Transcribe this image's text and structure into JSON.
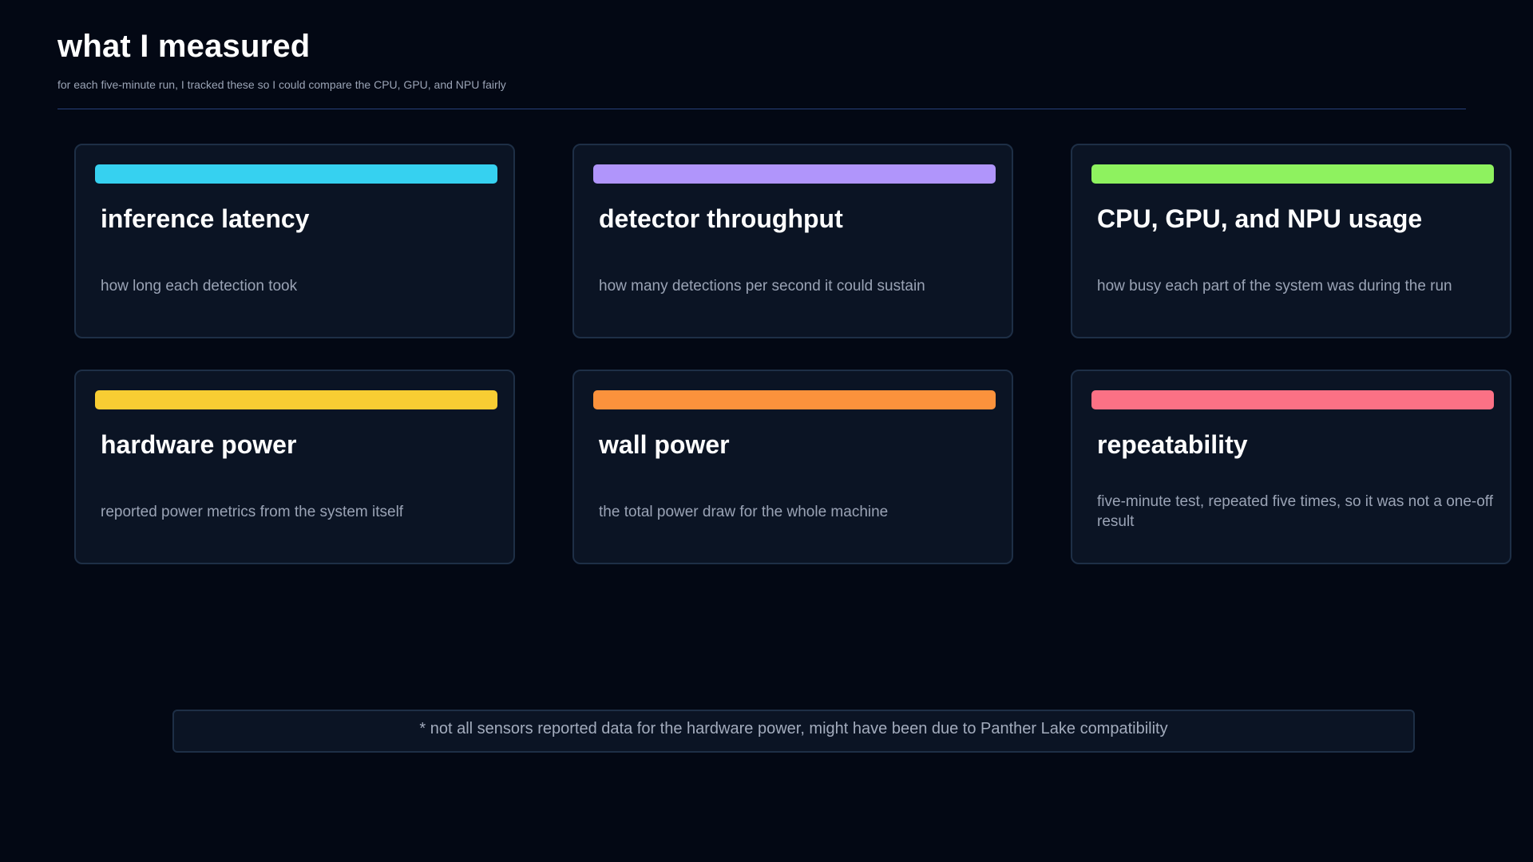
{
  "header": {
    "title": "what I measured",
    "subtitle": "for each five-minute run, I tracked these so I could compare the CPU, GPU, and NPU fairly"
  },
  "cards": [
    {
      "title": "inference latency",
      "description": "how long each detection took",
      "accent_color": "#36d1f0"
    },
    {
      "title": "detector throughput",
      "description": "how many detections per second it could sustain",
      "accent_color": "#b095fb"
    },
    {
      "title": "CPU, GPU, and NPU usage",
      "description": "how busy each part of the system was during the run",
      "accent_color": "#8ef25f"
    },
    {
      "title": "hardware power",
      "description": "reported power metrics from the system itself",
      "accent_color": "#f8cd33"
    },
    {
      "title": "wall power",
      "description": "the total power draw for the whole machine",
      "accent_color": "#fb923c"
    },
    {
      "title": "repeatability",
      "description": "five-minute test, repeated five times, so it was not a one-off result",
      "accent_color": "#fb7185"
    }
  ],
  "footnote": {
    "text": "* not all sensors reported data for the hardware power, might have been due to Panther Lake compatibility"
  }
}
